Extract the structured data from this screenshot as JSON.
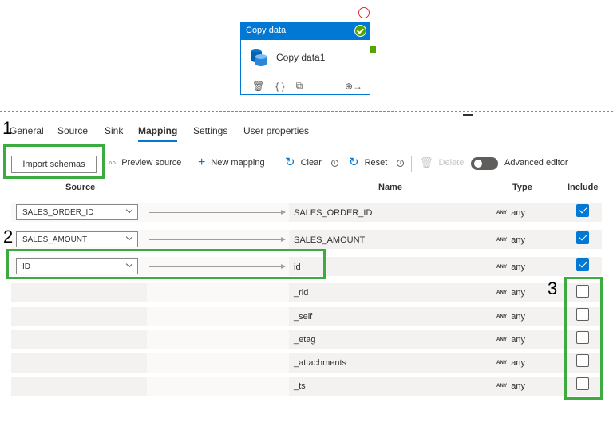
{
  "activity": {
    "type_label": "Copy data",
    "name": "Copy data1",
    "status_color": "#57a300",
    "header_color": "#0078d4",
    "footer_icons": [
      "delete-icon",
      "code-icon",
      "clone-icon",
      "connect-icon"
    ]
  },
  "tabs": [
    "General",
    "Source",
    "Sink",
    "Mapping",
    "Settings",
    "User properties"
  ],
  "active_tab": "Mapping",
  "toolbar": {
    "import_schemas": "Import schemas",
    "preview_source": "Preview source",
    "new_mapping": "New mapping",
    "clear": "Clear",
    "reset": "Reset",
    "delete": "Delete",
    "advanced_editor": "Advanced editor",
    "advanced_editor_on": false
  },
  "columns": {
    "source": "Source",
    "name": "Name",
    "type": "Type",
    "include": "Include"
  },
  "mappings": [
    {
      "source": "SALES_ORDER_ID",
      "name": "SALES_ORDER_ID",
      "type_badge": "ANY",
      "type": "any",
      "include": true
    },
    {
      "source": "SALES_AMOUNT",
      "name": "SALES_AMOUNT",
      "type_badge": "ANY",
      "type": "any",
      "include": true
    },
    {
      "source": "ID",
      "name": "id",
      "type_badge": "ANY",
      "type": "any",
      "include": true
    },
    {
      "source": "",
      "name": "_rid",
      "type_badge": "ANY",
      "type": "any",
      "include": false
    },
    {
      "source": "",
      "name": "_self",
      "type_badge": "ANY",
      "type": "any",
      "include": false
    },
    {
      "source": "",
      "name": "_etag",
      "type_badge": "ANY",
      "type": "any",
      "include": false
    },
    {
      "source": "",
      "name": "_attachments",
      "type_badge": "ANY",
      "type": "any",
      "include": false
    },
    {
      "source": "",
      "name": "_ts",
      "type_badge": "ANY",
      "type": "any",
      "include": false
    }
  ],
  "annotations": {
    "step1": "1",
    "step2": "2",
    "step3": "3",
    "color": "#3dab3f"
  },
  "colors": {
    "accent": "#0078d4",
    "success": "#57a300"
  }
}
